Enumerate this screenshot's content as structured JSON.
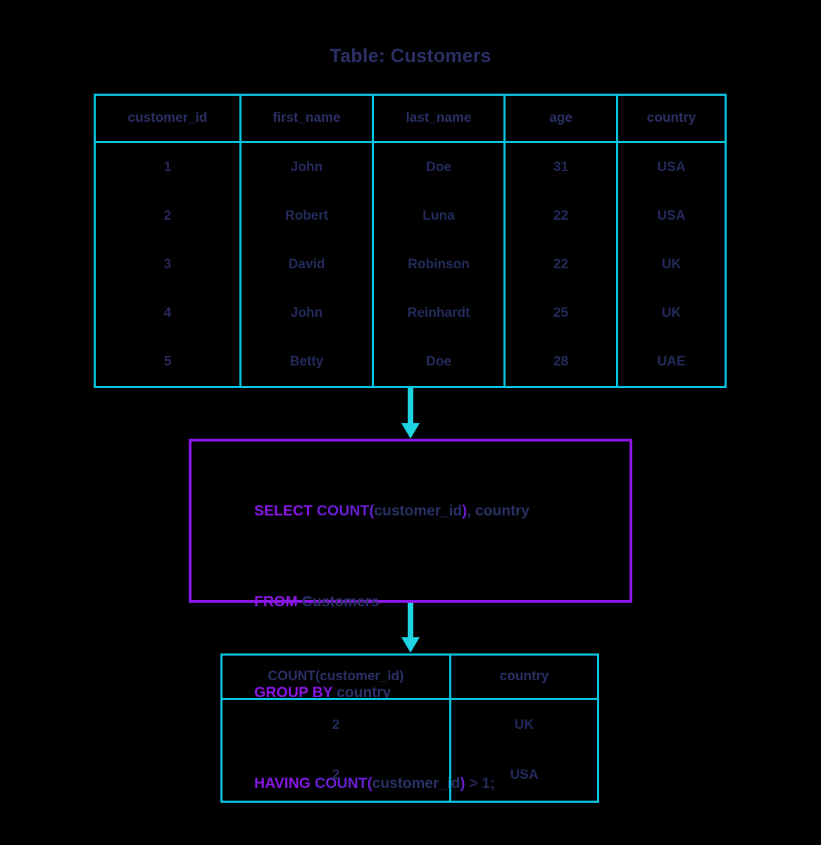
{
  "title": "Table: Customers",
  "source_table": {
    "name": "Customers",
    "columns": [
      "customer_id",
      "first_name",
      "last_name",
      "age",
      "country"
    ],
    "rows": [
      [
        "1",
        "John",
        "Doe",
        "31",
        "USA"
      ],
      [
        "2",
        "Robert",
        "Luna",
        "22",
        "USA"
      ],
      [
        "3",
        "David",
        "Robinson",
        "22",
        "UK"
      ],
      [
        "4",
        "John",
        "Reinhardt",
        "25",
        "UK"
      ],
      [
        "5",
        "Betty",
        "Doe",
        "28",
        "UAE"
      ]
    ]
  },
  "query": {
    "lines": [
      [
        {
          "text": "SELECT ",
          "type": "keyword"
        },
        {
          "text": "COUNT(",
          "type": "keyword"
        },
        {
          "text": "customer_id",
          "type": "identifier"
        },
        {
          "text": ")",
          "type": "keyword"
        },
        {
          "text": ", country",
          "type": "identifier"
        }
      ],
      [
        {
          "text": "FROM ",
          "type": "keyword"
        },
        {
          "text": "Customers",
          "type": "identifier"
        }
      ],
      [
        {
          "text": "GROUP BY ",
          "type": "keyword"
        },
        {
          "text": "country",
          "type": "identifier"
        }
      ],
      [
        {
          "text": "HAVING ",
          "type": "keyword"
        },
        {
          "text": "COUNT(",
          "type": "keyword"
        },
        {
          "text": "customer_id",
          "type": "identifier"
        },
        {
          "text": ")",
          "type": "keyword"
        },
        {
          "text": " > 1;",
          "type": "operator"
        }
      ]
    ],
    "full_text": "SELECT COUNT(customer_id), country\nFROM Customers\nGROUP BY country\nHAVING COUNT(customer_id) > 1;"
  },
  "result_table": {
    "columns": [
      "COUNT(customer_id)",
      "country"
    ],
    "rows": [
      [
        "2",
        "UK"
      ],
      [
        "2",
        "USA"
      ]
    ]
  },
  "arrows": [
    {
      "name": "arrow-table-to-query",
      "direction": "down"
    },
    {
      "name": "arrow-query-to-result",
      "direction": "down"
    }
  ],
  "colors": {
    "background": "#000000",
    "table_border": "#08C6E2",
    "arrow": "#1FD3E2",
    "query_border": "#8B17E8",
    "keyword": "#8B17E8",
    "identifier": "#2b3167",
    "text_navy": "#252b5c"
  }
}
